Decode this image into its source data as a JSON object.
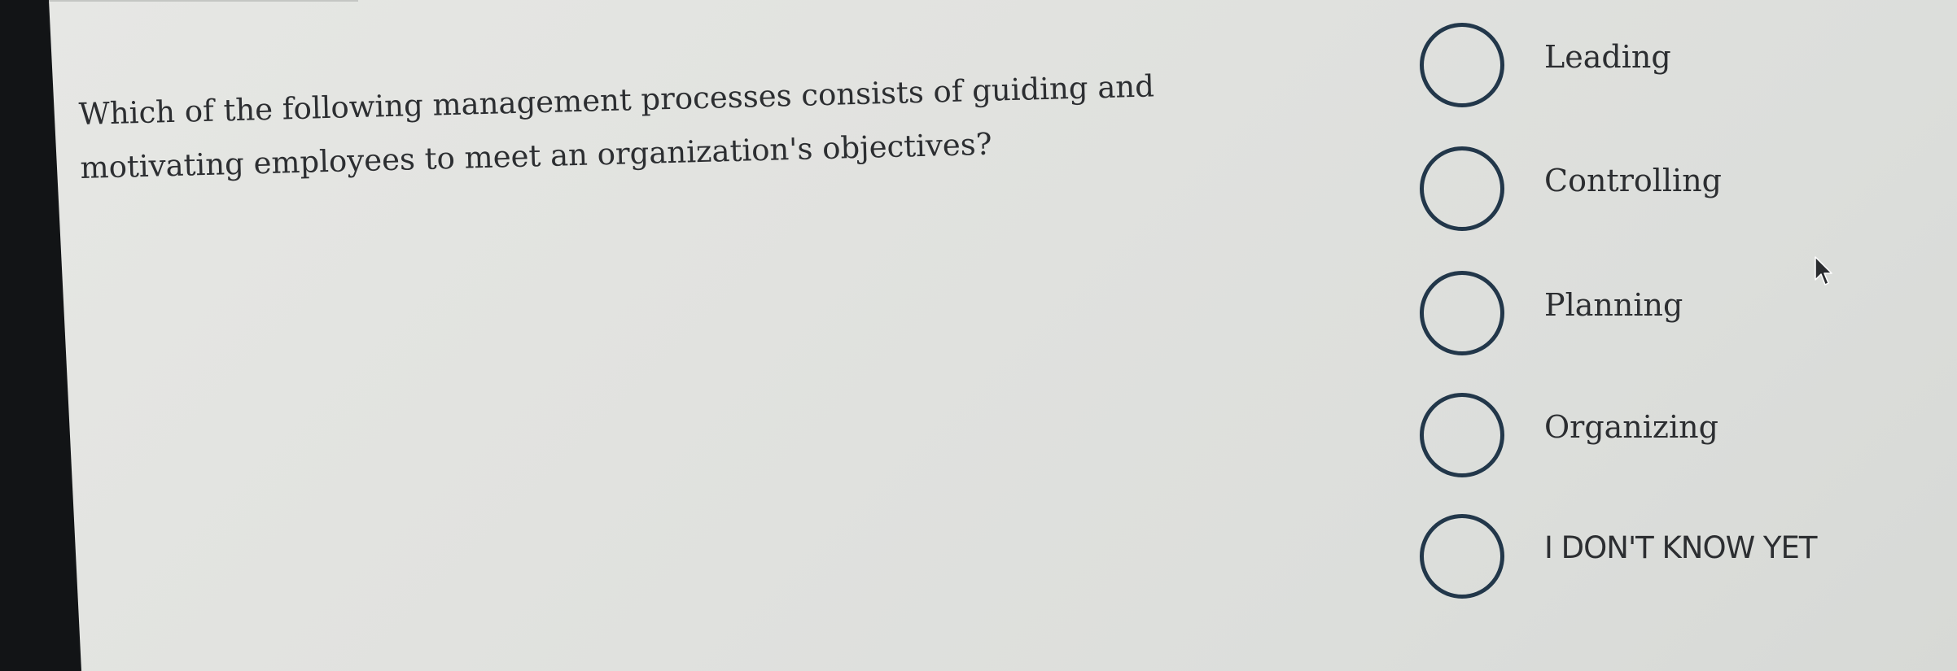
{
  "question": {
    "text": "Which of the following management processes consists of guiding and motivating employees to meet an organization's objectives?"
  },
  "options": [
    {
      "label": "Leading",
      "selected": false
    },
    {
      "label": "Controlling",
      "selected": false
    },
    {
      "label": "Planning",
      "selected": false
    },
    {
      "label": "Organizing",
      "selected": false
    },
    {
      "label": "I DON'T KNOW YET",
      "selected": false
    }
  ],
  "colors": {
    "radio_border": "#22374a",
    "text": "#2c2e31",
    "page_background": "#e1e2df",
    "screen_bezel": "#121416"
  },
  "icons": {
    "cursor": "mouse-pointer-icon"
  }
}
